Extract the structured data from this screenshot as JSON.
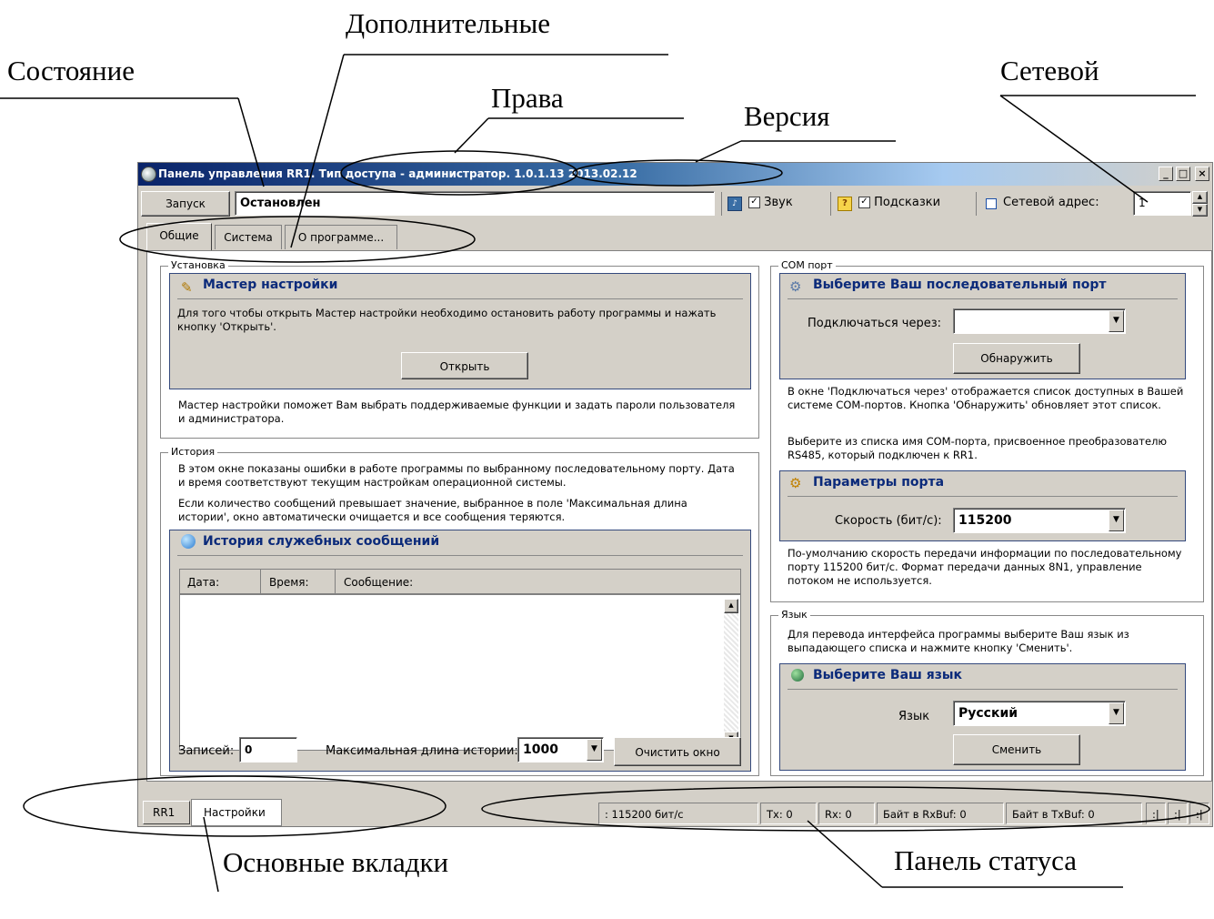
{
  "callouts": {
    "state": "Состояние",
    "extra": "Дополнительные",
    "rights": "Права",
    "version": "Версия",
    "network": "Сетевой",
    "main_tabs": "Основные вкладки",
    "status_panel": "Панель статуса"
  },
  "window": {
    "title": "Панель управления RR1. Тип доступа - администратор. 1.0.1.13 2013.02.12"
  },
  "toolbar": {
    "start_label": "Запуск",
    "status_value": "Остановлен",
    "sound_label": "Звук",
    "sound_checked": "✓",
    "hints_label": "Подсказки",
    "hints_checked": "✓",
    "net_address_label": "Сетевой адрес:",
    "net_address_value": "1"
  },
  "tabs": [
    "Общие",
    "Система",
    "О программе..."
  ],
  "setup": {
    "group_label": "Установка",
    "panel_title": "Мастер настройки",
    "text1": "Для того чтобы открыть Мастер настройки необходимо остановить работу программы и нажать кнопку 'Открыть'.",
    "open_button": "Открыть",
    "text2": "Мастер настройки поможет Вам выбрать поддерживаемые функции и задать пароли пользователя и администратора."
  },
  "history": {
    "group_label": "История",
    "text1": "В этом окне показаны ошибки в работе программы по выбранному последовательному порту. Дата и время соответствуют текущим настройкам операционной системы.",
    "text2": "Если количество сообщений превышает значение, выбранное в поле 'Максимальная длина истории', окно автоматически очищается и все сообщения теряются.",
    "panel_title": "История служебных сообщений",
    "columns": [
      "Дата:",
      "Время:",
      "Сообщение:"
    ],
    "records_label": "Записей:",
    "records_value": "0",
    "max_len_label": "Максимальная длина истории:",
    "max_len_value": "1000",
    "clear_button": "Очистить окно"
  },
  "com": {
    "group_label": "COM порт",
    "panel_title": "Выберите Ваш последовательный порт",
    "connect_label": "Подключаться через:",
    "connect_value": "",
    "detect_button": "Обнаружить",
    "text1": "В окне 'Подключаться через' отображается список доступных в Вашей системе COM-портов. Кнопка 'Обнаружить' обновляет этот список.",
    "text2": "Выберите из списка имя COM-порта, присвоенное преобразователю RS485, который подключен к RR1.",
    "params_title": "Параметры порта",
    "speed_label": "Скорость (бит/с):",
    "speed_value": "115200",
    "text3": "По-умолчанию скорость передачи информации по последовательному порту 115200 бит/с. Формат передачи данных 8N1, управление потоком не используется."
  },
  "lang": {
    "group_label": "Язык",
    "text1": "Для перевода интерфейса программы выберите Ваш язык из выпадающего списка и нажмите кнопку 'Сменить'.",
    "panel_title": "Выберите Ваш язык",
    "lang_label": "Язык",
    "lang_value": "Русский",
    "change_button": "Сменить"
  },
  "bottom_tabs": [
    "RR1",
    "Настройки"
  ],
  "statusbar": {
    "speed": ": 115200 бит/с",
    "tx": "Tx: 0",
    "rx": "Rx: 0",
    "rxbuf": "Байт в RxBuf: 0",
    "txbuf": "Байт в TxBuf: 0",
    "c1": ":|",
    "c2": ":|",
    "c3": ":|"
  },
  "colors": {
    "title_start": "#0a246a",
    "panel_title": "#0b2a7a",
    "face": "#d4d0c8"
  }
}
